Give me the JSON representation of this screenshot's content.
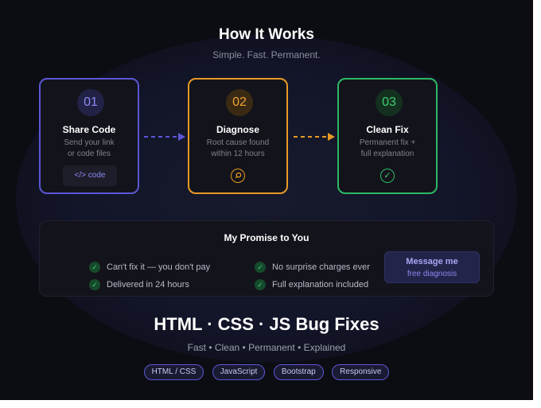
{
  "header": {
    "title": "How It Works",
    "subtitle": "Simple. Fast. Permanent."
  },
  "steps": [
    {
      "number": "01",
      "title": "Share Code",
      "desc_line1": "Send your link",
      "desc_line2": "or code files",
      "chip_label": "</> code",
      "color": "#5b57d6"
    },
    {
      "number": "02",
      "title": "Diagnose",
      "desc_line1": "Root cause found",
      "desc_line2": "within 12 hours",
      "icon": "search-icon",
      "color": "#e79a24"
    },
    {
      "number": "03",
      "title": "Clean Fix",
      "desc_line1": "Permanent fix +",
      "desc_line2": "full explanation",
      "icon": "check-icon",
      "color": "#2eb864"
    }
  ],
  "promise": {
    "title": "My Promise to You",
    "items": [
      "Can't fix it — you don't pay",
      "Delivered in 24 hours",
      "No surprise charges ever",
      "Full explanation included"
    ],
    "cta_label": "Message me",
    "cta_sublabel": "free diagnosis"
  },
  "footer": {
    "headline": "HTML · CSS · JS Bug Fixes",
    "tagline": "Fast • Clean • Permanent • Explained",
    "tags": [
      "HTML / CSS",
      "JavaScript",
      "Bootstrap",
      "Responsive"
    ]
  },
  "colors": {
    "background": "#0c0d12",
    "accent_purple": "#5b57d6",
    "accent_orange": "#e79a24",
    "accent_green": "#2eb864"
  }
}
